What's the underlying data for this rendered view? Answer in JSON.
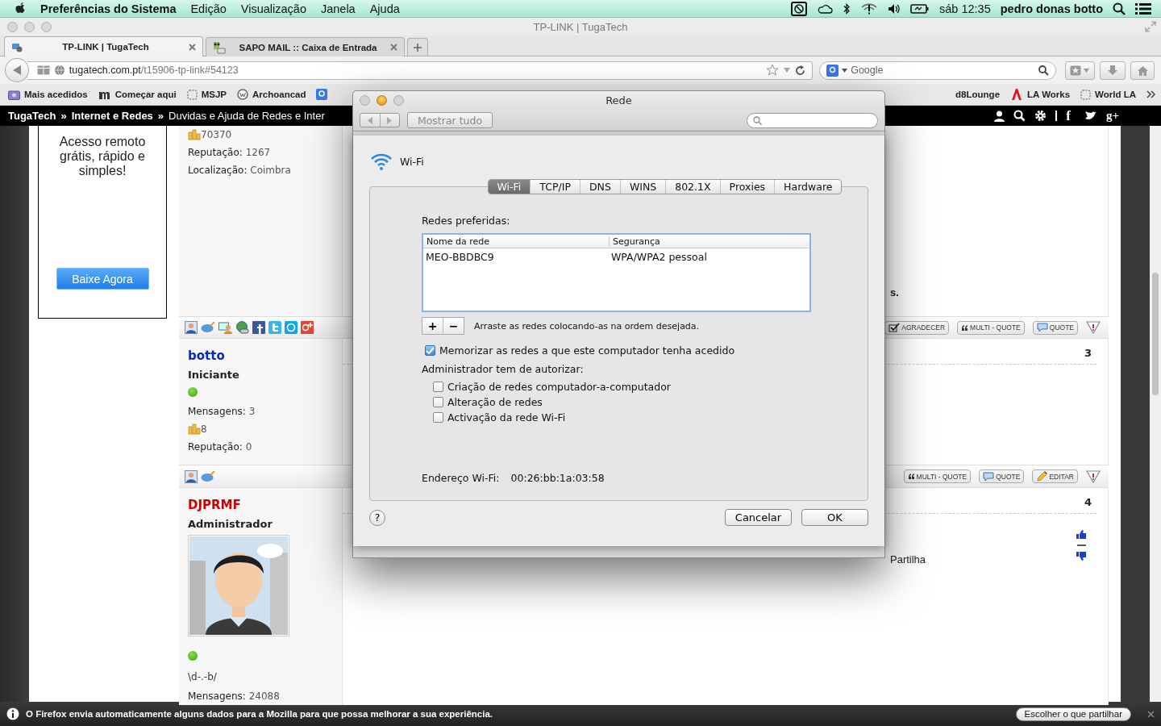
{
  "menubar": {
    "app": "Preferências do Sistema",
    "menus": [
      "Edição",
      "Visualização",
      "Janela",
      "Ajuda"
    ],
    "clock": "sáb 12:35",
    "user": "pedro donas botto"
  },
  "browser": {
    "title": "TP-LINK | TugaTech",
    "tabs": [
      {
        "label": "TP-LINK | TugaTech",
        "selected": true
      },
      {
        "label": "SAPO MAIL :: Caixa de Entrada",
        "selected": false
      }
    ],
    "url": {
      "host": "tugatech.com.pt",
      "path": "/t15906-tp-link#54123"
    },
    "search": {
      "value": "Google"
    },
    "bookmarks": [
      {
        "label": "Mais acedidos",
        "kind": "folder"
      },
      {
        "label": "Começar aqui",
        "kind": "m"
      },
      {
        "label": "MSJP",
        "kind": "blank"
      },
      {
        "label": "Archoancad",
        "kind": "circle"
      },
      {
        "kind": "g"
      }
    ],
    "bookmarks_right": [
      {
        "label": "d8Lounge",
        "kind": "none"
      },
      {
        "label": "LA Works",
        "kind": "logo"
      },
      {
        "label": "World LA",
        "kind": "blank"
      }
    ],
    "nav": [
      {
        "label": "TugaTech",
        "kind": "link"
      },
      {
        "label": "»",
        "kind": "sep"
      },
      {
        "label": "Internet e Redes",
        "kind": "link"
      },
      {
        "label": "»",
        "kind": "sep"
      },
      {
        "label": "Duvidas e Ajuda de Redes e Inter",
        "kind": "current"
      }
    ],
    "nav_social": [
      "f",
      "g+"
    ]
  },
  "forum": {
    "ad": {
      "text": "Acesso remoto grátis, rápido e simples!",
      "button": "Baixe Agora"
    },
    "posts": [
      {
        "rows": [
          {
            "kind": "points",
            "value": "70370"
          },
          {
            "kind": "field",
            "label": "Reputação:",
            "value": "1267"
          },
          {
            "kind": "field",
            "label": "Localização:",
            "value": "Coimbra"
          }
        ],
        "text": "s.",
        "social_links": true,
        "actions": [
          {
            "label": "AGRADECER",
            "kind": "thanks"
          },
          {
            "label": "MULTI - QUOTE",
            "kind": "multiquote"
          },
          {
            "label": "QUOTE",
            "kind": "quote"
          }
        ]
      },
      {
        "number": "3",
        "rows": [
          {
            "kind": "name",
            "value": "botto",
            "color": "#0a2bb8"
          },
          {
            "kind": "role",
            "value": "Iniciante"
          },
          {
            "kind": "status",
            "online": true
          },
          {
            "kind": "field",
            "label": "Mensagens:",
            "value": "3"
          },
          {
            "kind": "points",
            "value": "8"
          },
          {
            "kind": "field",
            "label": "Reputação:",
            "value": "0"
          }
        ],
        "social_links": false,
        "actions": [
          {
            "label": "MULTI - QUOTE",
            "kind": "multiquote"
          },
          {
            "label": "QUOTE",
            "kind": "quote"
          },
          {
            "label": "EDITAR",
            "kind": "edit"
          }
        ]
      },
      {
        "number": "4",
        "rows": [
          {
            "kind": "name",
            "value": "DJPRMF",
            "color": "#cc0000"
          },
          {
            "kind": "role",
            "value": "Administrador"
          },
          {
            "kind": "avatar"
          },
          {
            "kind": "status",
            "online": true
          },
          {
            "kind": "signature",
            "value": "\\d-.-b/"
          },
          {
            "kind": "field",
            "label": "Mensagens:",
            "value": "24088"
          }
        ],
        "text": "Partilha",
        "votes": true
      }
    ]
  },
  "dialog": {
    "title": "Rede",
    "show_all": "Mostrar tudo",
    "section": "Wi-Fi",
    "tabs": [
      {
        "label": "Wi-Fi",
        "selected": true
      },
      {
        "label": "TCP/IP",
        "selected": false
      },
      {
        "label": "DNS",
        "selected": false
      },
      {
        "label": "WINS",
        "selected": false
      },
      {
        "label": "802.1X",
        "selected": false
      },
      {
        "label": "Proxies",
        "selected": false
      },
      {
        "label": "Hardware",
        "selected": false
      }
    ],
    "preferred_label": "Redes preferidas:",
    "columns": [
      "Nome da rede",
      "Segurança"
    ],
    "networks": [
      {
        "name": "MEO-BBDBC9",
        "security": "WPA/WPA2 pessoal"
      }
    ],
    "add": "+",
    "remove": "−",
    "hint": "Arraste as redes colocando-as na ordem desejada.",
    "remember": {
      "label": "Memorizar as redes a que este computador tenha acedido",
      "checked": true
    },
    "admin_label": "Administrador tem de autorizar:",
    "admin_options": [
      {
        "label": "Criação de redes computador-a-computador",
        "checked": false
      },
      {
        "label": "Alteração de redes",
        "checked": false
      },
      {
        "label": "Activação da rede Wi-Fi",
        "checked": false
      }
    ],
    "address_label": "Endereço Wi-Fi:",
    "address": "00:26:bb:1a:03:58",
    "help": "?",
    "buttons": [
      "Cancelar",
      "OK"
    ]
  },
  "notification": {
    "text": "O Firefox envia automaticamente alguns dados para a Mozilla para que possa melhorar a sua experiência.",
    "button": "Escolher o que partilhar"
  }
}
